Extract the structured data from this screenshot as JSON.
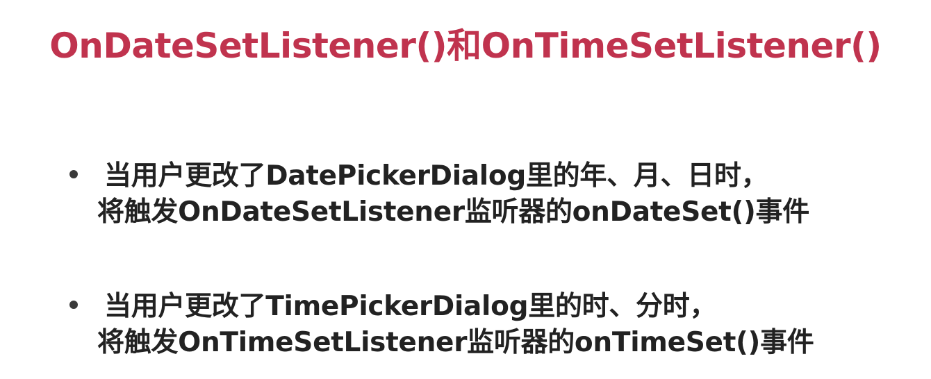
{
  "slide": {
    "title": "OnDateSetListener()和OnTimeSetListener()",
    "bullets": [
      {
        "line1": "当用户更改了DatePickerDialog里的年、月、日时，",
        "line2": "将触发OnDateSetListener监听器的onDateSet()事件"
      },
      {
        "line1": "当用户更改了TimePickerDialog里的时、分时，",
        "line2": "将触发OnTimeSetListener监听器的onTimeSet()事件"
      }
    ]
  },
  "colors": {
    "title": "#c0334e",
    "body_text": "#222222",
    "bullet": "#3a3a3a",
    "background": "#ffffff"
  }
}
